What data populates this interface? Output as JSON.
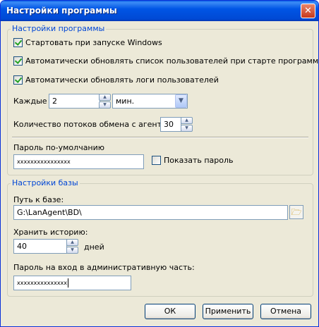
{
  "window": {
    "title": "Настройки программы"
  },
  "program_settings": {
    "legend": "Настройки программы",
    "start_with_windows": {
      "label": "Стартовать при запуске Windows",
      "checked": true
    },
    "auto_update_users": {
      "label": "Автоматически обновлять список пользователей при старте программы",
      "checked": true
    },
    "auto_update_logs": {
      "label": "Автоматически обновлять логи пользователей",
      "checked": true
    },
    "every_label": "Каждые",
    "every_value": "2",
    "every_unit": "мин.",
    "threads_label": "Количество потоков обмена с агентом:",
    "threads_value": "30",
    "password_label": "Пароль по-умолчанию",
    "password_value": "xxxxxxxxxxxxxxxx",
    "show_password_label": "Показать пароль"
  },
  "db_settings": {
    "legend": "Настройки базы",
    "path_label": "Путь к базе:",
    "path_value": "G:\\LanAgent\\BD\\",
    "history_label": "Хранить историю:",
    "history_value": "40",
    "history_unit": "дней",
    "admin_password_label": "Пароль на вход в административную часть:",
    "admin_password_value": "xxxxxxxxxxxxxxx"
  },
  "buttons": {
    "ok": "ОК",
    "apply": "Применить",
    "cancel": "Отмена"
  }
}
